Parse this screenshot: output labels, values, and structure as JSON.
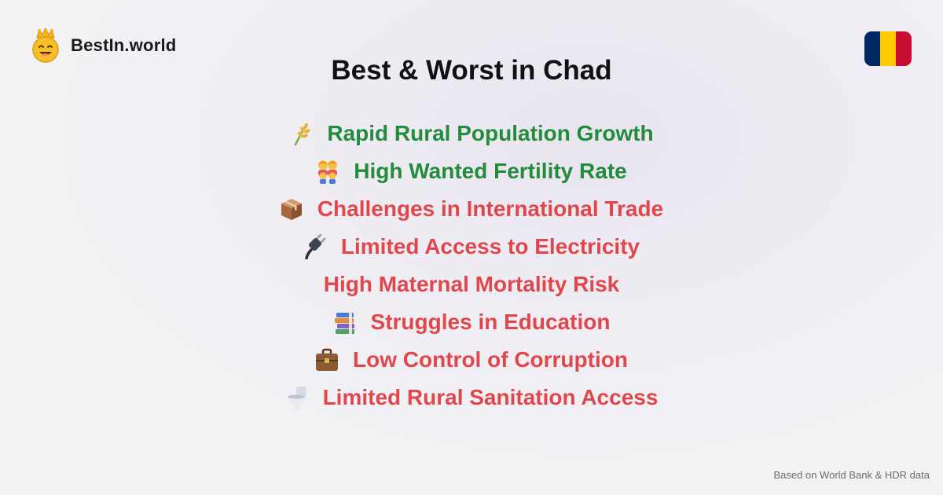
{
  "brand": {
    "name": "BestIn.world",
    "logo_icon": "crowned-smiley-icon"
  },
  "page": {
    "title": "Best & Worst in Chad"
  },
  "flag": {
    "icon": "chad-flag-icon",
    "colors": [
      "#002664",
      "#FECB00",
      "#C60C30"
    ]
  },
  "colors": {
    "good": "#228b3c",
    "bad": "#e0474c"
  },
  "items": [
    {
      "label": "Rapid Rural Population Growth",
      "icon": "sheaf-of-rice-icon",
      "kind": "good"
    },
    {
      "label": "High Wanted Fertility Rate",
      "icon": "family-icon",
      "kind": "good"
    },
    {
      "label": "Challenges in International Trade",
      "icon": "package-icon",
      "kind": "bad"
    },
    {
      "label": "Limited Access to Electricity",
      "icon": "electric-plug-icon",
      "kind": "bad"
    },
    {
      "label": "High Maternal Mortality Risk",
      "icon": "",
      "kind": "bad"
    },
    {
      "label": "Struggles in Education",
      "icon": "books-icon",
      "kind": "bad"
    },
    {
      "label": "Low Control of Corruption",
      "icon": "briefcase-icon",
      "kind": "bad"
    },
    {
      "label": "Limited Rural Sanitation Access",
      "icon": "toilet-icon",
      "kind": "bad"
    }
  ],
  "footer": {
    "text": "Based on World Bank & HDR data"
  }
}
